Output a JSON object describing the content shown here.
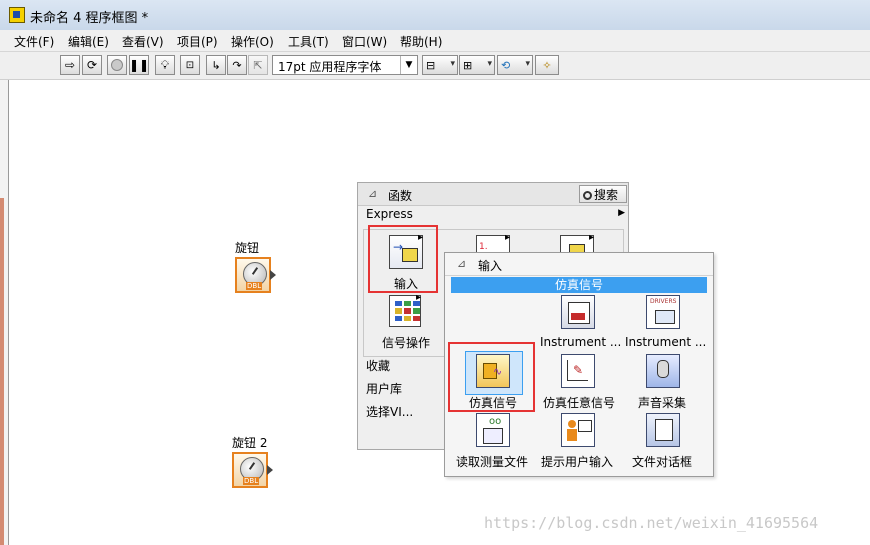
{
  "window": {
    "title": "未命名 4 程序框图 *"
  },
  "menu": [
    "文件(F)",
    "编辑(E)",
    "查看(V)",
    "项目(P)",
    "操作(O)",
    "工具(T)",
    "窗口(W)",
    "帮助(H)"
  ],
  "toolbar": {
    "font_value": "17pt 应用程序字体"
  },
  "canvas": {
    "knob1_label": "旋钮",
    "knob2_label": "旋钮 2",
    "knob_tag": "DBL"
  },
  "palette": {
    "title": "函数",
    "search_label": "搜索",
    "express_label": "Express",
    "icon_labels": {
      "input": "输入",
      "signal_ops": "信号操作"
    },
    "side_items": [
      "收藏",
      "用户库",
      "选择VI..."
    ]
  },
  "submenu": {
    "title": "输入",
    "section": "仿真信号",
    "items": [
      "Instrument ...",
      "Instrument ...",
      "仿真信号",
      "仿真任意信号",
      "声音采集",
      "读取测量文件",
      "提示用户输入",
      "文件对话框"
    ]
  },
  "watermark": "https://blog.csdn.net/weixin_41695564",
  "colors": {
    "highlight": "#3c9ff0",
    "annotation": "#e53333",
    "knob_border": "#e6811e"
  },
  "icons": [
    "labview-vi-icon",
    "run-arrow-icon",
    "run-continuous-icon",
    "abort-icon",
    "pause-icon",
    "highlight-execution-icon",
    "retain-wire-values-icon",
    "step-into-icon",
    "step-over-icon",
    "step-out-icon",
    "align-icon",
    "distribute-icon",
    "reorder-icon",
    "clean-diagram-icon",
    "pin-icon",
    "search-icon"
  ]
}
